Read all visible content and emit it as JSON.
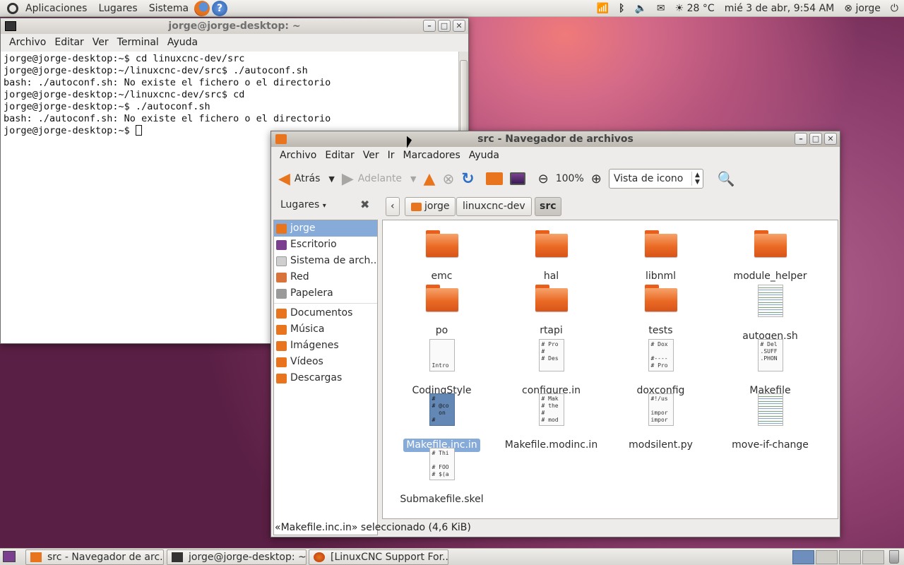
{
  "top_panel": {
    "menus": [
      "Aplicaciones",
      "Lugares",
      "Sistema"
    ],
    "weather": "28 °C",
    "datetime": "mié  3 de abr,  9:54 AM",
    "user": "jorge"
  },
  "terminal": {
    "title": "jorge@jorge-desktop: ~",
    "menus": [
      "Archivo",
      "Editar",
      "Ver",
      "Terminal",
      "Ayuda"
    ],
    "lines": [
      "jorge@jorge-desktop:~$ cd linuxcnc-dev/src",
      "jorge@jorge-desktop:~/linuxcnc-dev/src$ ./autoconf.sh",
      "bash: ./autoconf.sh: No existe el fichero o el directorio",
      "jorge@jorge-desktop:~/linuxcnc-dev/src$ cd",
      "jorge@jorge-desktop:~$ ./autoconf.sh",
      "bash: ./autoconf.sh: No existe el fichero o el directorio",
      "jorge@jorge-desktop:~$ "
    ]
  },
  "browser": {
    "title": "src - Navegador de archivos",
    "menus": [
      "Archivo",
      "Editar",
      "Ver",
      "Ir",
      "Marcadores",
      "Ayuda"
    ],
    "toolbar": {
      "back": "Atrás",
      "forward": "Adelante",
      "zoom": "100%",
      "view": "Vista de icono"
    },
    "sidebar_header": "Lugares",
    "breadcrumbs": [
      "jorge",
      "linuxcnc-dev",
      "src"
    ],
    "places": [
      "jorge",
      "Escritorio",
      "Sistema de arch...",
      "Red",
      "Papelera"
    ],
    "bookmarks": [
      "Documentos",
      "Música",
      "Imágenes",
      "Vídeos",
      "Descargas"
    ],
    "files": [
      {
        "name": "emc",
        "kind": "folder"
      },
      {
        "name": "hal",
        "kind": "folder"
      },
      {
        "name": "libnml",
        "kind": "folder"
      },
      {
        "name": "module_helper",
        "kind": "folder"
      },
      {
        "name": "po",
        "kind": "folder"
      },
      {
        "name": "rtapi",
        "kind": "folder"
      },
      {
        "name": "tests",
        "kind": "folder"
      },
      {
        "name": "autogen.sh",
        "kind": "script",
        "preview": ""
      },
      {
        "name": "CodingStyle",
        "kind": "text",
        "preview": "\n\n\nIntro"
      },
      {
        "name": "configure.in",
        "kind": "text",
        "preview": "# Pro\n#\n# Des"
      },
      {
        "name": "doxconfig",
        "kind": "text",
        "preview": "# Dox\n\n#----\n# Pro"
      },
      {
        "name": "Makefile",
        "kind": "text",
        "preview": "# Del\n.SUFF\n.PHON"
      },
      {
        "name": "Makefile.inc.in",
        "kind": "selected",
        "preview": "#\n# @co\n  on\n#"
      },
      {
        "name": "Makefile.modinc.in",
        "kind": "text",
        "preview": "# Mak\n# the\n#\n# mod"
      },
      {
        "name": "modsilent.py",
        "kind": "text",
        "preview": "#!/us\n\nimpor\nimpor"
      },
      {
        "name": "move-if-change",
        "kind": "script",
        "preview": ""
      },
      {
        "name": "Submakefile.skel",
        "kind": "text",
        "preview": "# Thi\n\n# FOO\n# $(a"
      }
    ],
    "status": "«Makefile.inc.in» seleccionado (4,6 KiB)"
  },
  "taskbar": [
    "src - Navegador de arc...",
    "jorge@jorge-desktop: ~",
    "[LinuxCNC Support For..."
  ]
}
